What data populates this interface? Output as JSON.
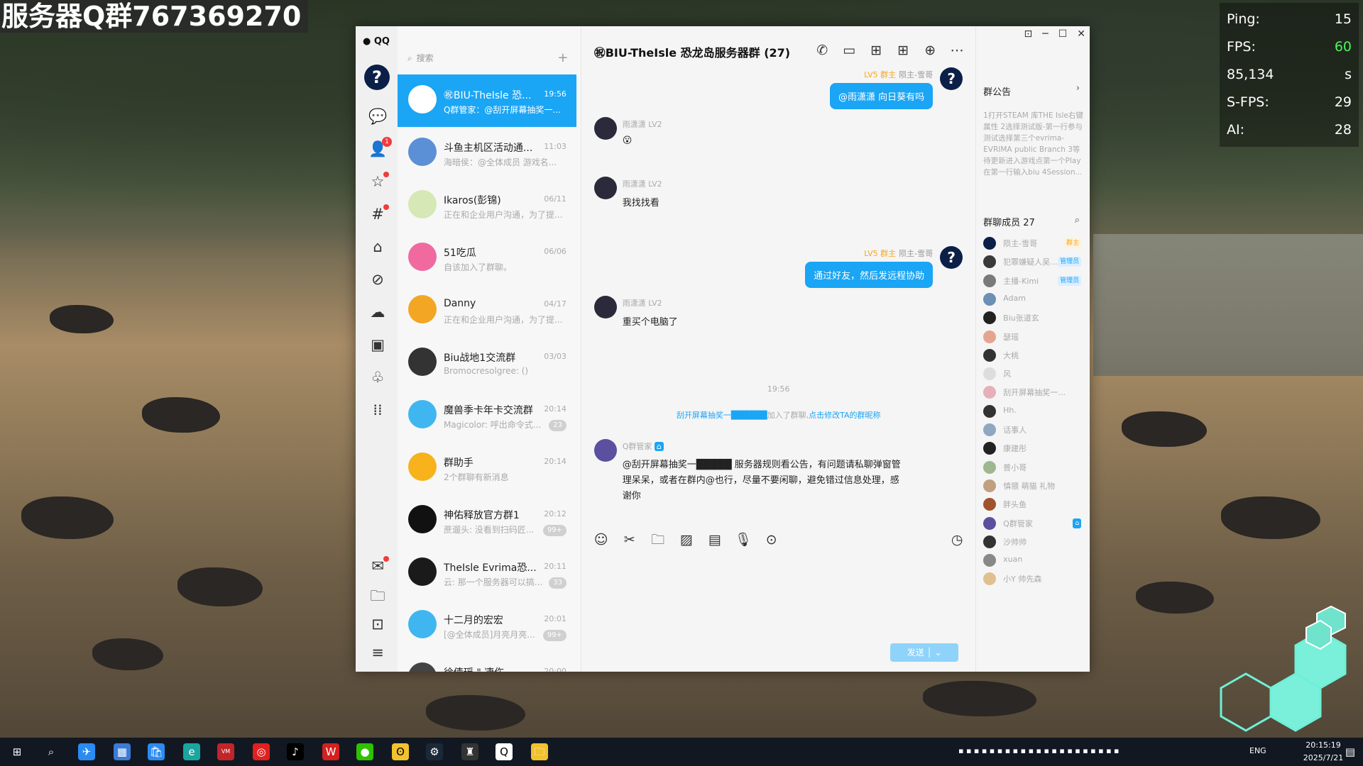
{
  "overlay": {
    "watermark": "服务器Q群767369270",
    "stats": [
      {
        "label": "Ping:",
        "value": "15",
        "highlight": false
      },
      {
        "label": "FPS:",
        "value": "60",
        "highlight": true
      },
      {
        "label": "85,134",
        "value": "s",
        "highlight": false
      },
      {
        "label": "S-FPS:",
        "value": "29",
        "highlight": false
      },
      {
        "label": "AI:",
        "value": "28",
        "highlight": false
      }
    ]
  },
  "rail": {
    "logo": "QQ",
    "avatar_glyph": "?",
    "contacts_badge": "1",
    "icons": [
      "chat-icon",
      "contacts-icon",
      "star-icon",
      "channel-icon",
      "book-icon",
      "link-icon",
      "cloud-icon",
      "game-icon",
      "penguin-icon",
      "apps-icon",
      "mail-icon",
      "folder-icon",
      "bookmark-icon",
      "menu-icon"
    ]
  },
  "list": {
    "search_placeholder": "搜索",
    "conversations": [
      {
        "name": "㊗BIU-TheIsle 恐...",
        "time": "19:56",
        "preview": "Q群管家：@刮开屏幕抽奖一...",
        "active": true,
        "avatar_color": "#ffffff",
        "count": ""
      },
      {
        "name": "斗鱼主机区活动通...",
        "time": "11:03",
        "preview": "海暗侯：@全体成员 游戏名...",
        "active": false,
        "avatar_color": "#5b8fd6",
        "count": ""
      },
      {
        "name": "Ikaros(彭锦)",
        "time": "06/11",
        "preview": "正在和企业用户沟通，为了提...",
        "active": false,
        "avatar_color": "#d5e8b5",
        "count": ""
      },
      {
        "name": "51吃瓜",
        "time": "06/06",
        "preview": "自该加入了群聊。",
        "active": false,
        "avatar_color": "#f06aa0",
        "count": ""
      },
      {
        "name": "Danny",
        "time": "04/17",
        "preview": "正在和企业用户沟通，为了提...",
        "active": false,
        "avatar_color": "#f2a623",
        "count": ""
      },
      {
        "name": "Biu战地1交流群",
        "time": "03/03",
        "preview": "Bromocresolgree: ()",
        "active": false,
        "avatar_color": "#333333",
        "count": ""
      },
      {
        "name": "魔兽季卡年卡交流群",
        "time": "20:14",
        "preview": "Magicolor: 呼出命令式...",
        "active": false,
        "avatar_color": "#3fb6f0",
        "count": "23"
      },
      {
        "name": "群助手",
        "time": "20:14",
        "preview": "2个群聊有新消息",
        "active": false,
        "avatar_color": "#f7b21c",
        "count": ""
      },
      {
        "name": "神佑释放官方群1",
        "time": "20:12",
        "preview": "蔗遛头: 没看到扫码匠...",
        "active": false,
        "avatar_color": "#111111",
        "count": "99+"
      },
      {
        "name": "TheIsle Evrima恐...",
        "time": "20:11",
        "preview": "云: 那一个服务器可以搞...",
        "active": false,
        "avatar_color": "#1a1a1a",
        "count": "33"
      },
      {
        "name": "十二月的宏宏",
        "time": "20:01",
        "preview": "[@全体成员]月亮月亮...",
        "active": false,
        "avatar_color": "#3fb6f0",
        "count": "99+"
      },
      {
        "name": "徐倩瑶 \" 凄伤",
        "time": "20:00",
        "preview": "",
        "active": false,
        "avatar_color": "#444444",
        "count": ""
      }
    ]
  },
  "chat": {
    "title": "㊗BIU-TheIsle 恐龙岛服务器群 (27)",
    "messages": [
      {
        "side": "right",
        "lv": "LV5 群主",
        "sender": "陨主-雪哥",
        "text": "@雨潇潇 向日葵有吗"
      },
      {
        "side": "left",
        "sender": "雨潇潇",
        "lv": "LV2",
        "text": "😮"
      },
      {
        "side": "left",
        "sender": "雨潇潇",
        "lv": "LV2",
        "text": "我找找看"
      },
      {
        "side": "right",
        "lv": "LV5 群主",
        "sender": "陨主-雪哥",
        "text": "通过好友，然后发远程协助"
      },
      {
        "side": "left",
        "sender": "雨潇潇",
        "lv": "LV2",
        "text": "重买个电脑了"
      }
    ],
    "time_divider": "19:56",
    "system_msg": {
      "who": "刮开屏幕抽奖一██████",
      "mid": "加入了群聊,",
      "link": "点击修改TA的群昵称"
    },
    "bot_msg": {
      "sender": "Q群管家",
      "text": "@刮开屏幕抽奖一█████ 服务器规则看公告，有问题请私聊弹窗管理呆呆，或者在群内@也行，尽量不要闲聊，避免错过信息处理，感谢你"
    },
    "send_label": "发送"
  },
  "side": {
    "announcement_title": "群公告",
    "announcement_text": "1打开STEAM 库THE Isle右键属性 2选择测试版-第一行参与测试选择第三个evrima-EVRIMA public Branch 3等待更新进入游戏点第一个Play 在第一行输入biu 4Session...",
    "members_title": "群聊成员 27",
    "members": [
      {
        "name": "陨主-雪哥",
        "tag": "群主",
        "tag_type": "owner",
        "color": "#0b1f47"
      },
      {
        "name": "犯罪嫌疑人吴...",
        "tag": "管理员",
        "tag_type": "admin",
        "color": "#3a3a3a"
      },
      {
        "name": "主播-Kimi",
        "tag": "管理员",
        "tag_type": "admin",
        "color": "#7a7a7a"
      },
      {
        "name": "Adam",
        "tag": "",
        "tag_type": "",
        "color": "#6b8fb5"
      },
      {
        "name": "Biu张道玄",
        "tag": "",
        "tag_type": "",
        "color": "#222222"
      },
      {
        "name": "瑟瑶",
        "tag": "",
        "tag_type": "",
        "color": "#e3a58f"
      },
      {
        "name": "大桃",
        "tag": "",
        "tag_type": "",
        "color": "#333333"
      },
      {
        "name": "风",
        "tag": "",
        "tag_type": "",
        "color": "#dddddd"
      },
      {
        "name": "刮开屏幕抽奖一████...",
        "tag": "",
        "tag_type": "",
        "color": "#e6b0b8"
      },
      {
        "name": "Hh.",
        "tag": "",
        "tag_type": "",
        "color": "#333333"
      },
      {
        "name": "话事人",
        "tag": "",
        "tag_type": "",
        "color": "#8fa7c2"
      },
      {
        "name": "康建彤",
        "tag": "",
        "tag_type": "",
        "color": "#222222"
      },
      {
        "name": "普小哥",
        "tag": "",
        "tag_type": "",
        "color": "#9db88f"
      },
      {
        "name": "慎猥 萌猫 礼物",
        "tag": "",
        "tag_type": "",
        "color": "#c0a080"
      },
      {
        "name": "胖头鱼",
        "tag": "",
        "tag_type": "",
        "color": "#a0522d"
      },
      {
        "name": "Q群管家",
        "tag": "⌂",
        "tag_type": "bot",
        "color": "#5b4fa0"
      },
      {
        "name": "沙帅帅",
        "tag": "",
        "tag_type": "",
        "color": "#333333"
      },
      {
        "name": "xuan",
        "tag": "",
        "tag_type": "",
        "color": "#888888"
      },
      {
        "name": "小Y 帅先森",
        "tag": "",
        "tag_type": "",
        "color": "#e0c090"
      }
    ]
  },
  "taskbar": {
    "lang": "ENG",
    "time": "20:15:19",
    "date": "2025/7/21"
  }
}
